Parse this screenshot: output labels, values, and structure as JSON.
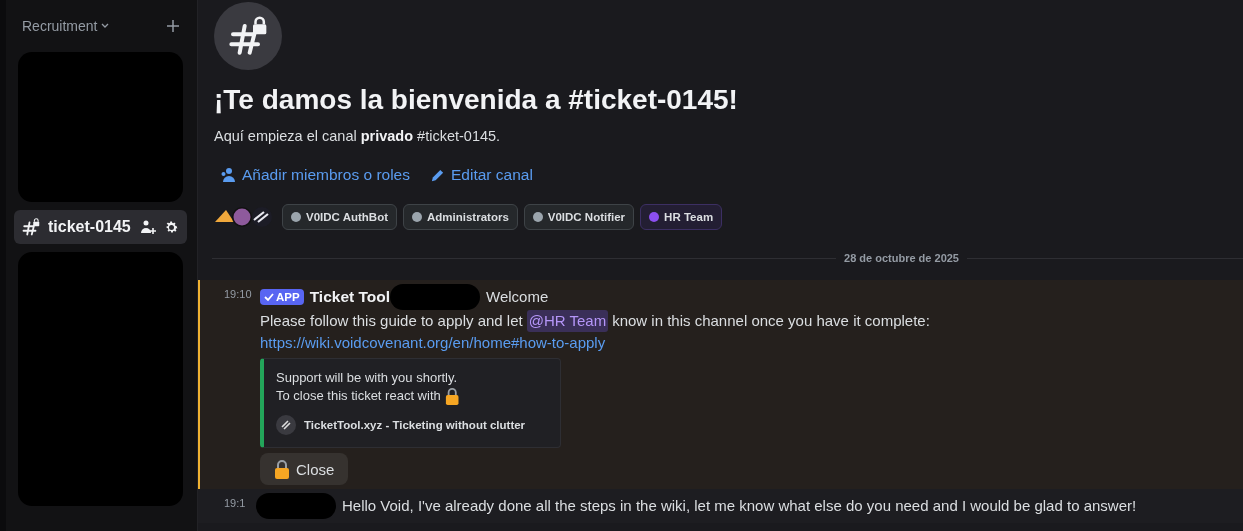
{
  "sidebar": {
    "category": "Recruitment",
    "channels": [
      {
        "name": "ticket-0145",
        "selected": true
      }
    ]
  },
  "welcome": {
    "title": "¡Te damos la bienvenida a #ticket-0145!",
    "subtitle": "Aquí empieza el canal **privado** #ticket-0145.",
    "actions": [
      {
        "kind": "members",
        "label": "Añadir miembros o roles"
      },
      {
        "kind": "edit",
        "label": "Editar canal"
      }
    ]
  },
  "roles": [
    {
      "name": "V0IDC AuthBot",
      "color": "#9ba5ad"
    },
    {
      "name": "Administrators",
      "color": "#9ba5ad"
    },
    {
      "name": "V0IDC Notifier",
      "color": "#9ba5ad"
    },
    {
      "name": "HR Team",
      "color": "#8c4ff0"
    }
  ],
  "date_divider": "28 de octubre de 2025",
  "messages": [
    {
      "time": "19:10",
      "badge": "APP",
      "author": "Ticket Tool",
      "highlighted": true,
      "title": "Welcome",
      "text_before": "Please follow this guide to apply and let",
      "mention": "@HR Team",
      "text_after": "know in this channel once you have it complete:",
      "link": "https://wiki.voidcovenant.org/en/home#how-to-apply",
      "embed": {
        "lines": [
          "Support will be with you shortly.",
          "To close this ticket react with"
        ],
        "footer": "TicketTool.xyz - Ticketing without clutter"
      },
      "button": "Close"
    },
    {
      "time": "19:1",
      "highlighted": false,
      "text": "Hello Void, I've already done all the steps in the wiki, let me know what else do you need and I would be glad to answer!"
    }
  ]
}
